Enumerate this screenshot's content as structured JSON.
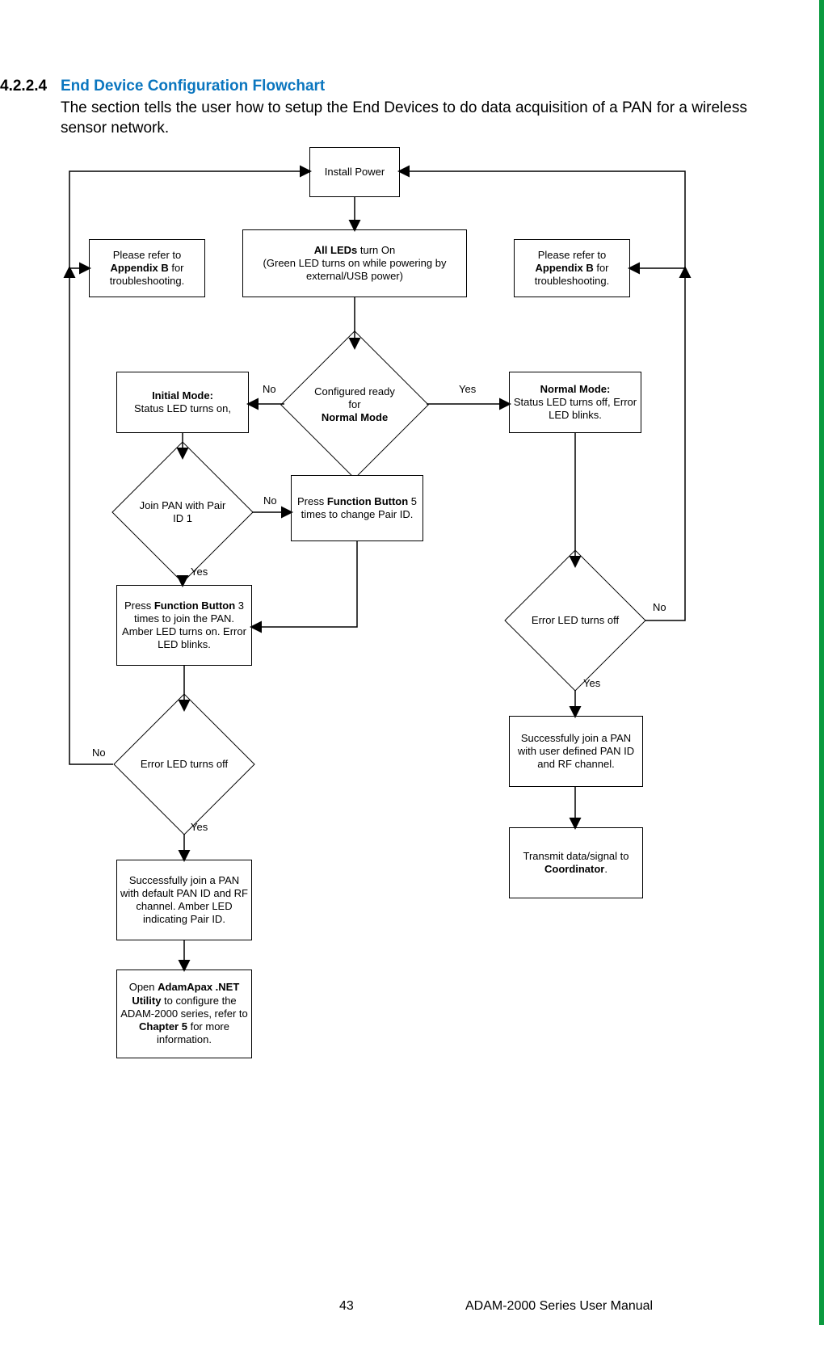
{
  "section_number": "4.2.2.4",
  "section_title": "End Device Configuration Flowchart",
  "intro_text": "The section tells the user how to setup the End Devices to do data acquisition of a PAN for a wireless sensor network.",
  "footer_page": "43",
  "footer_title": "ADAM-2000 Series User Manual",
  "nodes": {
    "install_power": "Install Power",
    "refer_left_pre": "Please refer to ",
    "refer_left_bold": "Appendix B",
    "refer_left_post": " for troubleshooting.",
    "leds_bold": "All LEDs",
    "leds_rest": " turn On",
    "leds_line2": "(Green LED turns on while powering by external/USB power)",
    "refer_right_pre": "Please refer to ",
    "refer_right_bold": "Appendix B",
    "refer_right_post": " for troubleshooting.",
    "cfg_line1": "Configured ready for",
    "cfg_bold": "Normal Mode",
    "initial_bold": "Initial Mode:",
    "initial_line2": "Status LED turns on,",
    "normal_bold": "Normal Mode:",
    "normal_line2": "Status LED turns off, Error LED blinks.",
    "join_pan": "Join PAN with Pair ID 1",
    "press5_pre": "Press ",
    "press5_bold": "Function Button",
    "press5_post": " 5 times to change Pair ID.",
    "press3_pre": "Press ",
    "press3_bold": "Function Button",
    "press3_post": " 3 times to join the PAN. Amber LED turns on. Error LED blinks.",
    "err_left": "Error LED turns off",
    "err_right": "Error LED turns off",
    "succ_left": "Successfully join a PAN with default PAN ID and RF channel. Amber LED indicating Pair ID.",
    "succ_right": "Successfully join a PAN with user defined PAN ID and RF channel.",
    "open_pre": "Open ",
    "open_bold": "AdamApax .NET Utility",
    "open_mid": " to configure the ADAM-2000 series, refer to ",
    "open_bold2": "Chapter 5",
    "open_post": " for more information.",
    "transmit_pre": "Transmit data/signal to ",
    "transmit_bold": "Coordinator",
    "transmit_post": "."
  },
  "labels": {
    "no1": "No",
    "yes1": "Yes",
    "no2": "No",
    "yes2": "Yes",
    "no3": "No",
    "yes3": "Yes",
    "no4": "No",
    "yes4": "Yes"
  }
}
